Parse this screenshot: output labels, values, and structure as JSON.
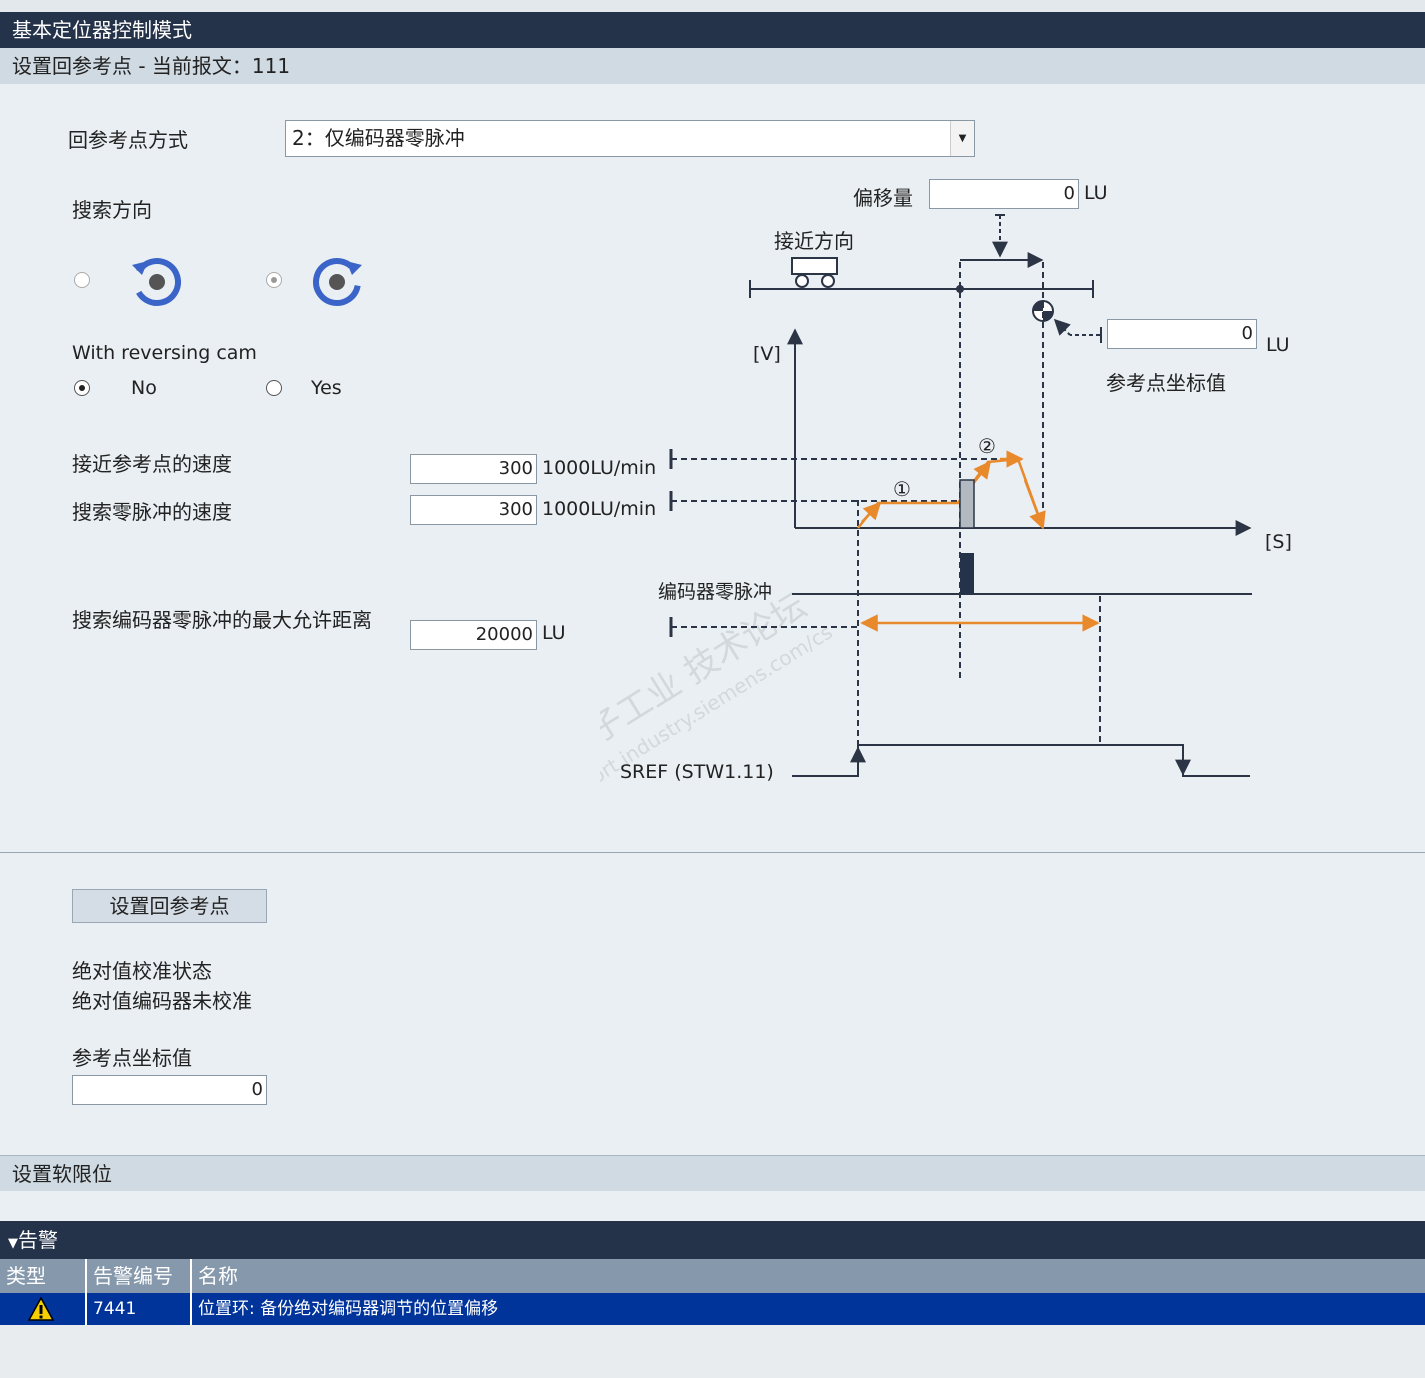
{
  "header": {
    "title": "基本定位器控制模式",
    "subtitle": "设置回参考点 - 当前报文：111"
  },
  "form": {
    "mode_label": "回参考点方式",
    "mode_value": "2：仅编码器零脉冲",
    "direction_label": "搜索方向",
    "reversing_cam_label": "With reversing cam",
    "reversing_no": "No",
    "reversing_yes": "Yes",
    "approach_speed_label": "接近参考点的速度",
    "approach_speed_value": "300",
    "approach_speed_unit": "1000LU/min",
    "search_speed_label": "搜索零脉冲的速度",
    "search_speed_value": "300",
    "search_speed_unit": "1000LU/min",
    "max_distance_label": "搜索编码器零脉冲的最大允许距离",
    "max_distance_value": "20000",
    "max_distance_unit": "LU"
  },
  "diagram": {
    "offset_label": "偏移量",
    "offset_value": "0",
    "offset_unit": "LU",
    "approach_dir_label": "接近方向",
    "ref_coord_value": "0",
    "ref_coord_unit": "LU",
    "ref_coord_label": "参考点坐标值",
    "v_axis": "[V]",
    "s_axis": "[S]",
    "marker1": "①",
    "marker2": "②",
    "zero_pulse_label": "编码器零脉冲",
    "sref_label": "SREF (STW1.11)",
    "watermark_line1": "西门子工业  技术论坛",
    "watermark_line2": "support.industry.siemens.com/cs",
    "colors": {
      "profile": "#e8892c",
      "line": "#2b3545"
    }
  },
  "actions": {
    "set_ref_button": "设置回参考点"
  },
  "status": {
    "abs_cal_label": "绝对值校准状态",
    "abs_cal_value": "绝对值编码器未校准",
    "ref_coord_label": "参考点坐标值",
    "ref_coord_value": "0"
  },
  "softlimit": {
    "label": "设置软限位"
  },
  "alarms": {
    "header": "告警",
    "columns": [
      "类型",
      "告警编号",
      "名称"
    ],
    "rows": [
      {
        "type_icon": "warning-icon",
        "number": "7441",
        "name": "位置环: 备份绝对编码器调节的位置偏移"
      }
    ]
  }
}
